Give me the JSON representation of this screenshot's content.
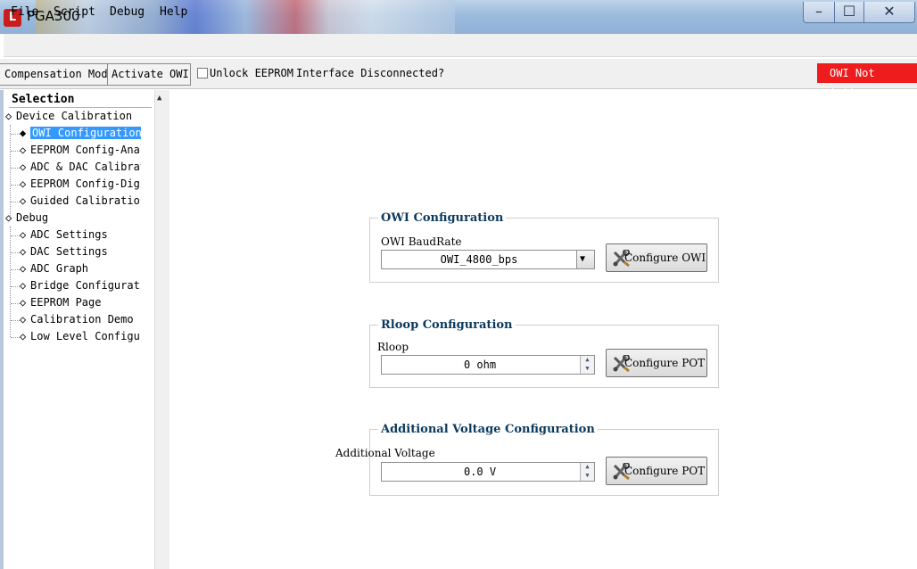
{
  "window": {
    "title": "PGA300",
    "icon_letter": "L",
    "min_glyph": "–",
    "max_glyph": "☐",
    "close_glyph": "✕"
  },
  "menu": [
    "File",
    "Script",
    "Debug",
    "Help"
  ],
  "toolbar": {
    "compensation_mode": "Compensation Mode",
    "activate_owi": "Activate OWI",
    "unlock_eeprom": "Unlock EEPROM",
    "unlock_eeprom_checked": false,
    "status": "Interface Disconnected?",
    "owi_status": "OWI  Not Active",
    "owi_status_color": "#ee1c1c"
  },
  "sidebar": {
    "header": "Selection",
    "groups": [
      {
        "label": "Device Calibration",
        "items": [
          "OWI Configuration",
          "EEPROM Config-Analog",
          "ADC & DAC Calibration",
          "EEPROM Config-Digital",
          "Guided Calibration"
        ]
      },
      {
        "label": "Debug",
        "items": [
          "ADC Settings",
          "DAC Settings",
          "ADC Graph",
          "Bridge Configuration",
          "EEPROM Page",
          "Calibration Demo",
          "Low Level Configuration"
        ]
      }
    ],
    "selected": "OWI Configuration",
    "selection_color": "#3399ff"
  },
  "main": {
    "owi": {
      "title": "OWI Configuration",
      "label": "OWI BaudRate",
      "value": "OWI_4800_bps",
      "button": "Configure OWI"
    },
    "rloop": {
      "title": "Rloop Configuration",
      "label": "Rloop",
      "value": "0 ohm",
      "button": "Configure POT"
    },
    "voltage": {
      "title": "Additional Voltage Configuration",
      "label": "Additional Voltage",
      "value": "0.0 V",
      "button": "Configure POT"
    }
  },
  "icons": {
    "tools": "tools-icon",
    "dropdown": "chevron-down-icon",
    "spin": "spin-arrows-icon"
  }
}
